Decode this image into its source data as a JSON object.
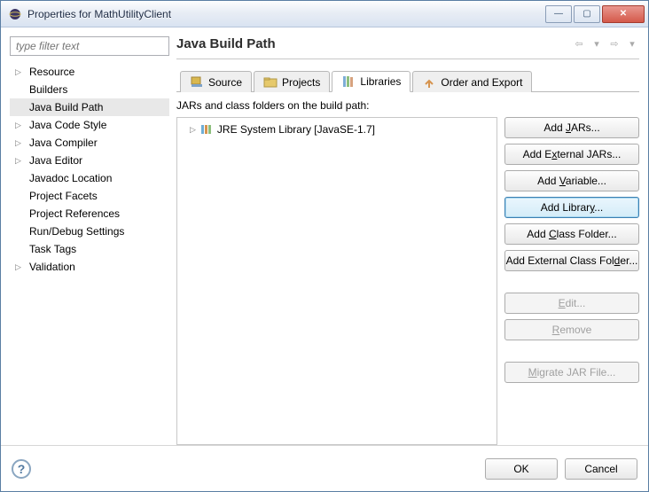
{
  "window": {
    "title": "Properties for MathUtilityClient"
  },
  "filter": {
    "placeholder": "type filter text"
  },
  "tree": [
    {
      "label": "Resource",
      "expandable": true
    },
    {
      "label": "Builders",
      "expandable": false
    },
    {
      "label": "Java Build Path",
      "expandable": false,
      "selected": true
    },
    {
      "label": "Java Code Style",
      "expandable": true
    },
    {
      "label": "Java Compiler",
      "expandable": true
    },
    {
      "label": "Java Editor",
      "expandable": true
    },
    {
      "label": "Javadoc Location",
      "expandable": false
    },
    {
      "label": "Project Facets",
      "expandable": false
    },
    {
      "label": "Project References",
      "expandable": false
    },
    {
      "label": "Run/Debug Settings",
      "expandable": false
    },
    {
      "label": "Task Tags",
      "expandable": false
    },
    {
      "label": "Validation",
      "expandable": true
    }
  ],
  "page": {
    "title": "Java Build Path"
  },
  "tabs": {
    "source": "Source",
    "projects": "Projects",
    "libraries": "Libraries",
    "order": "Order and Export"
  },
  "libTab": {
    "desc": "JARs and class folders on the build path:",
    "items": [
      {
        "label": "JRE System Library [JavaSE-1.7]"
      }
    ]
  },
  "buttons": {
    "addJars": "Add JARs...",
    "addExternalJars": "Add External JARs...",
    "addVariable": "Add Variable...",
    "addLibrary": "Add Library...",
    "addClassFolder": "Add Class Folder...",
    "addExternalClassFolder": "Add External Class Folder...",
    "edit": "Edit...",
    "remove": "Remove",
    "migrateJar": "Migrate JAR File..."
  },
  "footer": {
    "ok": "OK",
    "cancel": "Cancel"
  }
}
